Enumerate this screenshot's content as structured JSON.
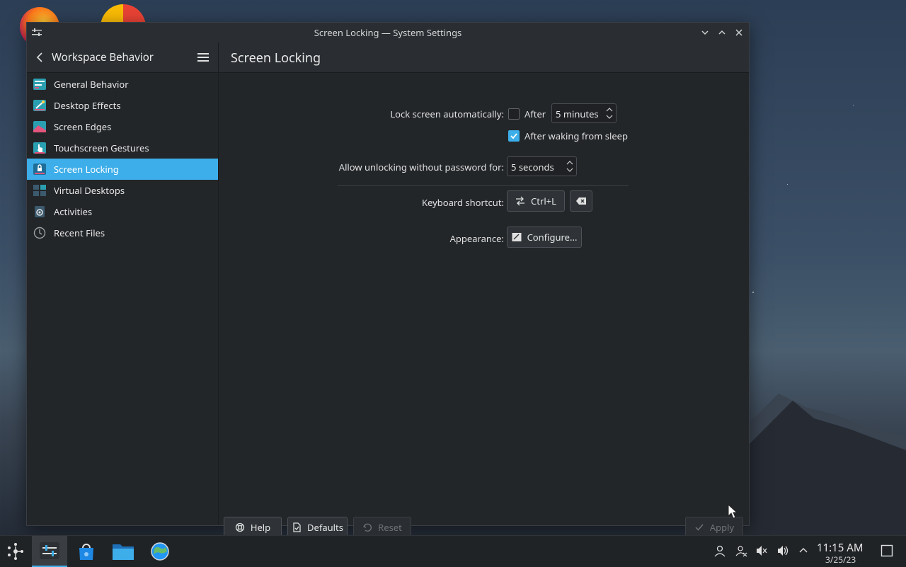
{
  "window": {
    "title": "Screen Locking — System Settings"
  },
  "sidebar": {
    "title": "Workspace Behavior",
    "items": [
      {
        "label": "General Behavior"
      },
      {
        "label": "Desktop Effects"
      },
      {
        "label": "Screen Edges"
      },
      {
        "label": "Touchscreen Gestures"
      },
      {
        "label": "Screen Locking"
      },
      {
        "label": "Virtual Desktops"
      },
      {
        "label": "Activities"
      },
      {
        "label": "Recent Files"
      }
    ]
  },
  "main": {
    "title": "Screen Locking",
    "lock_auto": {
      "label": "Lock screen automatically:",
      "after_label": "After",
      "after_checked": false,
      "after_value": "5 minutes",
      "waking_label": "After waking from sleep",
      "waking_checked": true
    },
    "unlock": {
      "label": "Allow unlocking without password for:",
      "value": "5 seconds"
    },
    "shortcut": {
      "label": "Keyboard shortcut:",
      "value": "Ctrl+L"
    },
    "appearance": {
      "label": "Appearance:",
      "button": "Configure..."
    }
  },
  "footer": {
    "help": "Help",
    "defaults": "Defaults",
    "reset": "Reset",
    "apply": "Apply"
  },
  "taskbar": {
    "time": "11:15 AM",
    "date": "3/25/23"
  },
  "colors": {
    "accent": "#3daee9",
    "window_bg": "#232629",
    "header_bg": "#2a2e32"
  }
}
